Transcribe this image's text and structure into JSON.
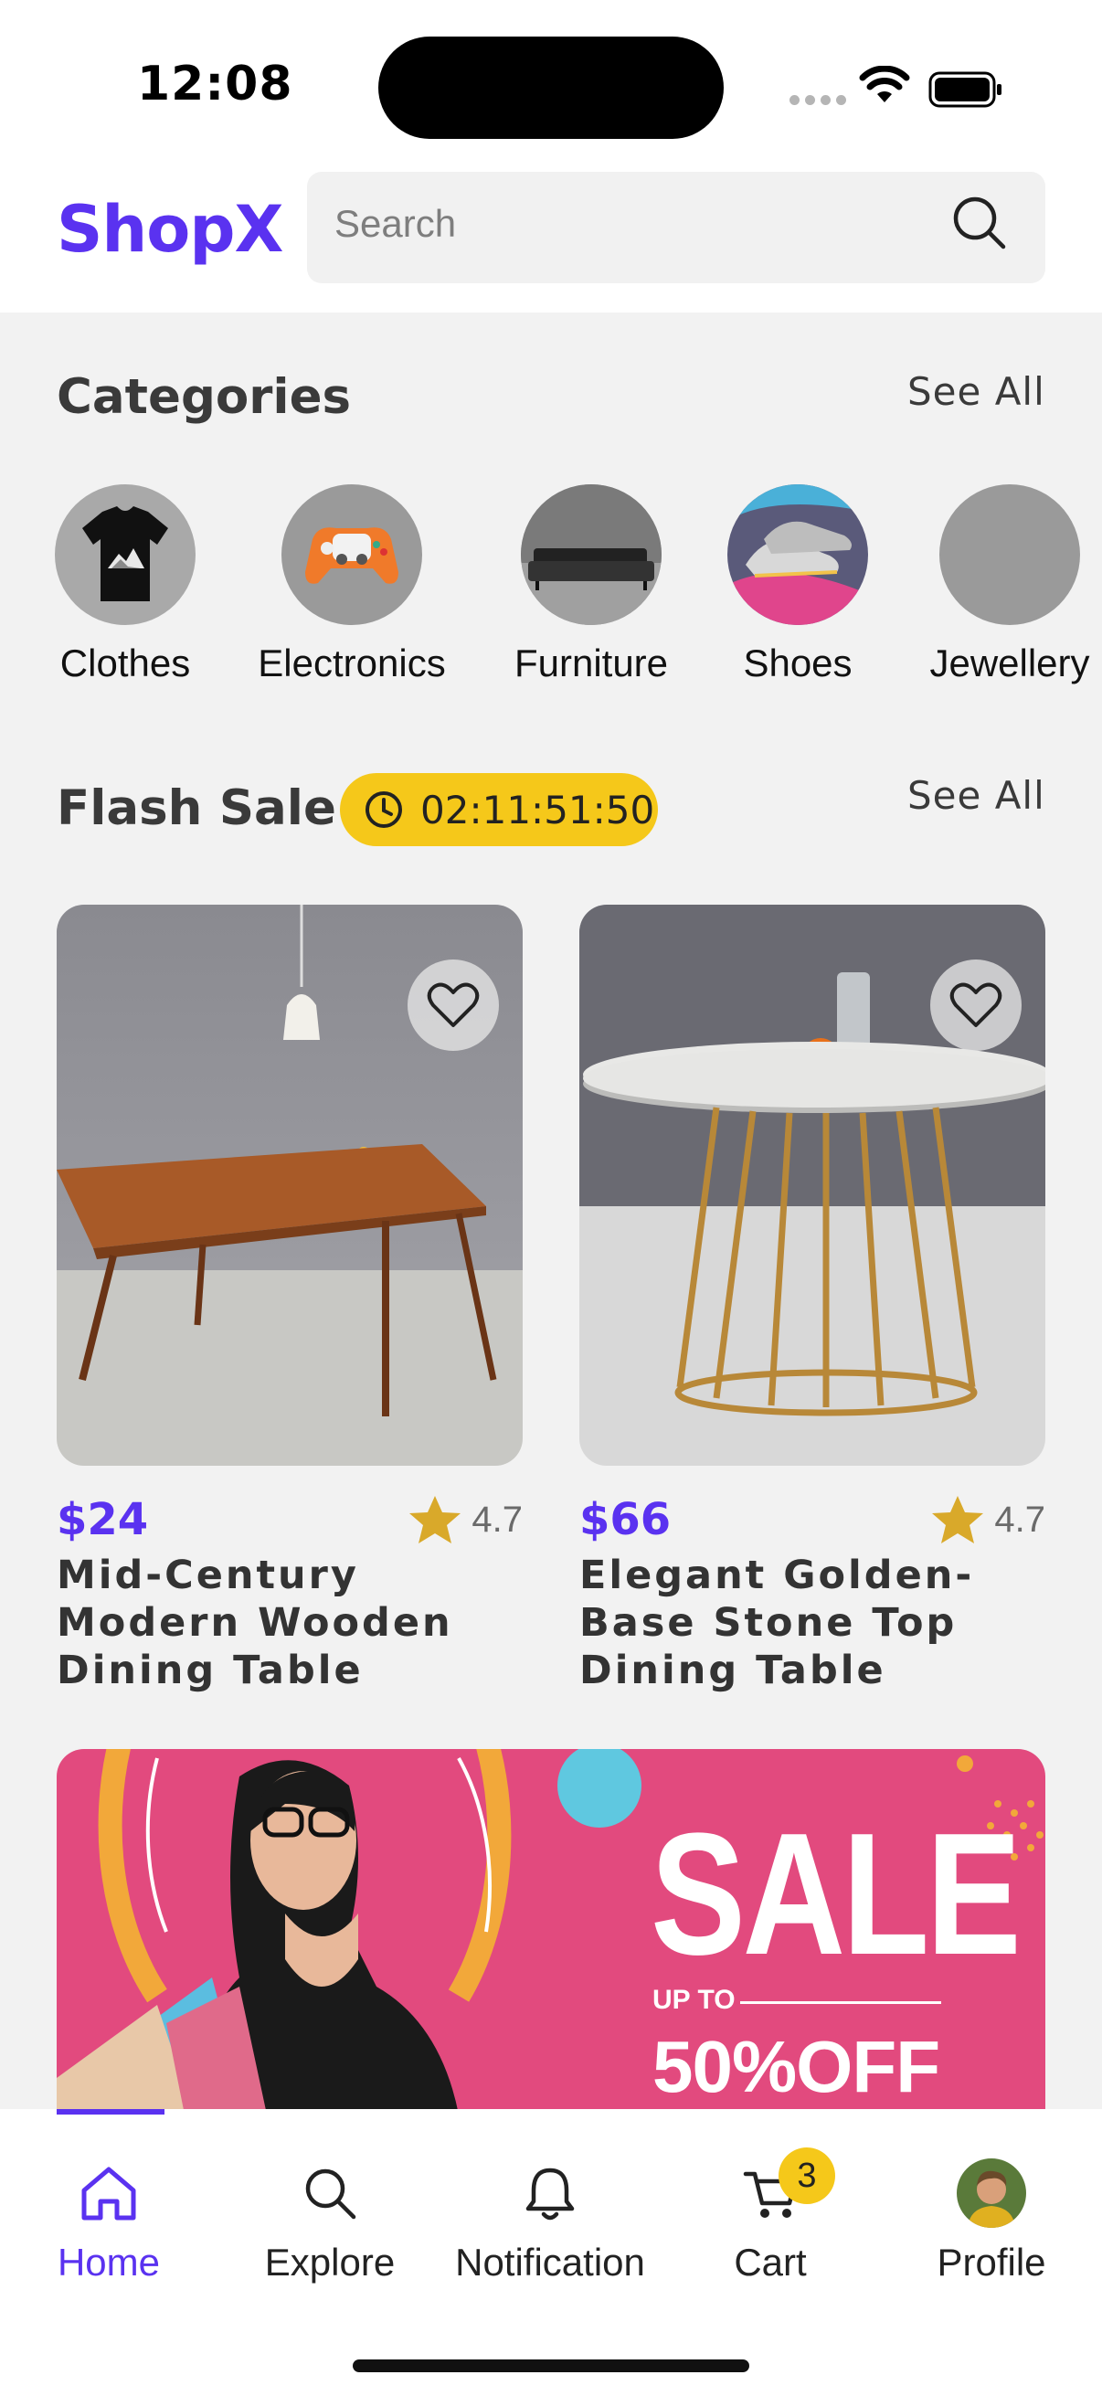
{
  "status_bar": {
    "time": "12:08"
  },
  "header": {
    "logo": "ShopX",
    "search": {
      "placeholder": "Search",
      "value": ""
    }
  },
  "categories": {
    "title": "Categories",
    "see_all": "See All",
    "items": [
      {
        "label": "Clothes"
      },
      {
        "label": "Electronics"
      },
      {
        "label": "Furniture"
      },
      {
        "label": "Shoes"
      },
      {
        "label": "Jewellery"
      }
    ]
  },
  "flash_sale": {
    "title": "Flash Sale",
    "timer": "02:11:51:50",
    "see_all": "See All",
    "products": [
      {
        "price": "$24",
        "rating": "4.7",
        "name": "Mid-Century Modern Wooden Dining Table"
      },
      {
        "price": "$66",
        "rating": "4.7",
        "name": "Elegant Golden-Base Stone Top Dining Table"
      }
    ]
  },
  "banner": {
    "headline": "SALE",
    "upto": "UP TO",
    "offer": "50%OFF"
  },
  "tabbar": {
    "items": [
      {
        "label": "Home"
      },
      {
        "label": "Explore"
      },
      {
        "label": "Notification"
      },
      {
        "label": "Cart",
        "badge": "3"
      },
      {
        "label": "Profile"
      }
    ]
  },
  "colors": {
    "brand": "#5a32f0",
    "accent_yellow": "#f5c81a",
    "star": "#d9a92a",
    "banner_pink": "#e24a7e"
  },
  "icons": [
    "search-icon",
    "clock-icon",
    "heart-icon",
    "star-icon",
    "home-icon",
    "explore-icon",
    "bell-icon",
    "cart-icon",
    "wifi-icon",
    "battery-icon"
  ]
}
